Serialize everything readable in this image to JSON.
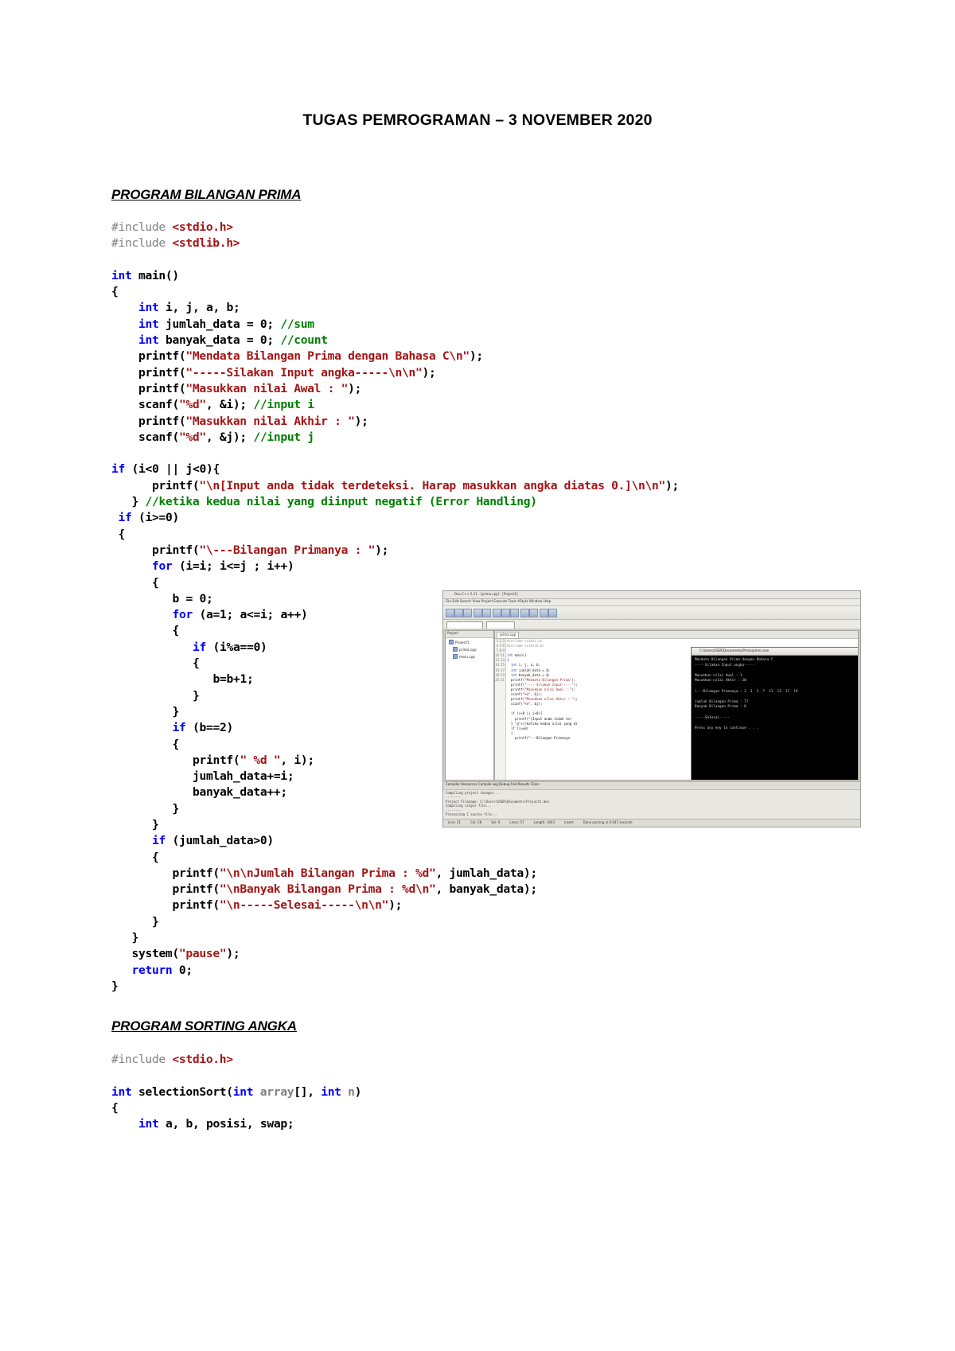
{
  "document": {
    "title": "TUGAS PEMROGRAMAN – 3 NOVEMBER 2020",
    "heading_prima": "PROGRAM BILANGAN PRIMA",
    "heading_sorting": "PROGRAM SORTING ANGKA"
  },
  "code_prima": {
    "lines": [
      "#include <stdio.h>",
      "#include <stdlib.h>",
      "",
      "int main()",
      "{",
      "    int i, j, a, b;",
      "    int jumlah_data = 0; //sum",
      "    int banyak_data = 0; //count",
      "    printf(\"Mendata Bilangan Prima dengan Bahasa C\\n\");",
      "    printf(\"-----Silakan Input angka-----\\n\\n\");",
      "    printf(\"Masukkan nilai Awal : \");",
      "    scanf(\"%d\", &i); //input i",
      "    printf(\"Masukkan nilai Akhir : \");",
      "    scanf(\"%d\", &j); //input j",
      "",
      "if (i<0 || j<0){",
      "      printf(\"\\n[Input anda tidak terdeteksi. Harap masukkan angka diatas 0.]\\n\\n\");",
      "   } //ketika kedua nilai yang diinput negatif (Error Handling)",
      " if (i>=0)",
      " {",
      "      printf(\"\\---Bilangan Primanya : \");",
      "      for (i=i; i<=j ; i++)",
      "      {",
      "         b = 0;",
      "         for (a=1; a<=i; a++)",
      "         {",
      "            if (i%a==0)",
      "            {",
      "               b=b+1;",
      "            }",
      "         }",
      "         if (b==2)",
      "         {",
      "            printf(\" %d \", i);",
      "            jumlah_data+=i;",
      "            banyak_data++;",
      "         }",
      "      }",
      "      if (jumlah_data>0)",
      "      {",
      "         printf(\"\\n\\nJumlah Bilangan Prima : %d\", jumlah_data);",
      "         printf(\"\\nBanyak Bilangan Prima : %d\\n\", banyak_data);",
      "         printf(\"\\n-----Selesai-----\\n\\n\");",
      "      }",
      "   }",
      "   system(\"pause\");",
      "   return 0;",
      "}"
    ]
  },
  "code_sorting": {
    "lines": [
      "#include <stdio.h>",
      "",
      "int selectionSort(int array[], int n)",
      "{",
      "    int a, b, posisi, swap;"
    ]
  },
  "screenshot": {
    "name": "dev-cpp-ide-screenshot",
    "window_title": "Dev-C++ 5.11 - [prima.cpp] - [Project1]",
    "menu": "File  Edit  Search  View  Project  Execute  Tools  AStyle  Window  Help",
    "project_panel_title": "Project",
    "project_tree": [
      "Project1",
      "prima.cpp",
      "main.cpp"
    ],
    "editor_tab": "prima.cpp",
    "editor_lines": [
      "#include <stdio.h>",
      "#include <stdlib.h>",
      "",
      "int main()",
      "{",
      "  int i, j, a, b;",
      "  int jumlah_data = 0;",
      "  int banyak_data = 0;",
      "  printf(\"Mendata Bilangan Prima\");",
      "  printf(\"-----Silakan Input-----\");",
      "  printf(\"Masukkan nilai Awal : \");",
      "  scanf(\"%d\", &i);",
      "  printf(\"Masukkan nilai Akhir : \");",
      "  scanf(\"%d\", &j);",
      "",
      "  if (i<0 || j<0){",
      "    printf(\"[Input anda tidak ter",
      "  } //ketika kedua nilai yang di",
      "  if (i>=0)",
      "  {",
      "    printf(\"---Bilangan Primanya"
    ],
    "console_title": "C:\\Users\\USER\\Documents\\Prima\\prima.exe",
    "console_lines": [
      "Mendata Bilangan Prima dengan Bahasa C",
      "-----Silakan Input angka-----",
      "",
      "Masukkan nilai Awal : 1",
      "Masukkan nilai Akhir : 20",
      "",
      "\\---Bilangan Primanya : 2  3  5  7  11  13  17  19",
      "",
      "Jumlah Bilangan Prima : 77",
      "Banyak Bilangan Prima : 8",
      "",
      "-----Selesai-----",
      "",
      "Press any key to continue . . ."
    ],
    "bottom_tabs": "Compiler   Resources   Compile Log   Debug   Find Results   Close",
    "bottom_log": [
      "Compiling project changes...",
      "--------",
      "Project Filename: C:\\Users\\USER\\Documents\\Project1.dev",
      "Compiling single file...",
      "--------",
      "Processing C source file..."
    ],
    "status_items": [
      "Line: 21",
      "Col: 28",
      "Sel: 0",
      "Lines: 57",
      "Length: 1043",
      "Insert",
      "Done parsing in 0.047 seconds"
    ]
  },
  "colors": {
    "keyword": "#0000ff",
    "string": "#a31515",
    "comment": "#008000",
    "preprocessor": "#808080",
    "identifier": "#808080",
    "text": "#000000",
    "page_bg": "#ffffff"
  }
}
